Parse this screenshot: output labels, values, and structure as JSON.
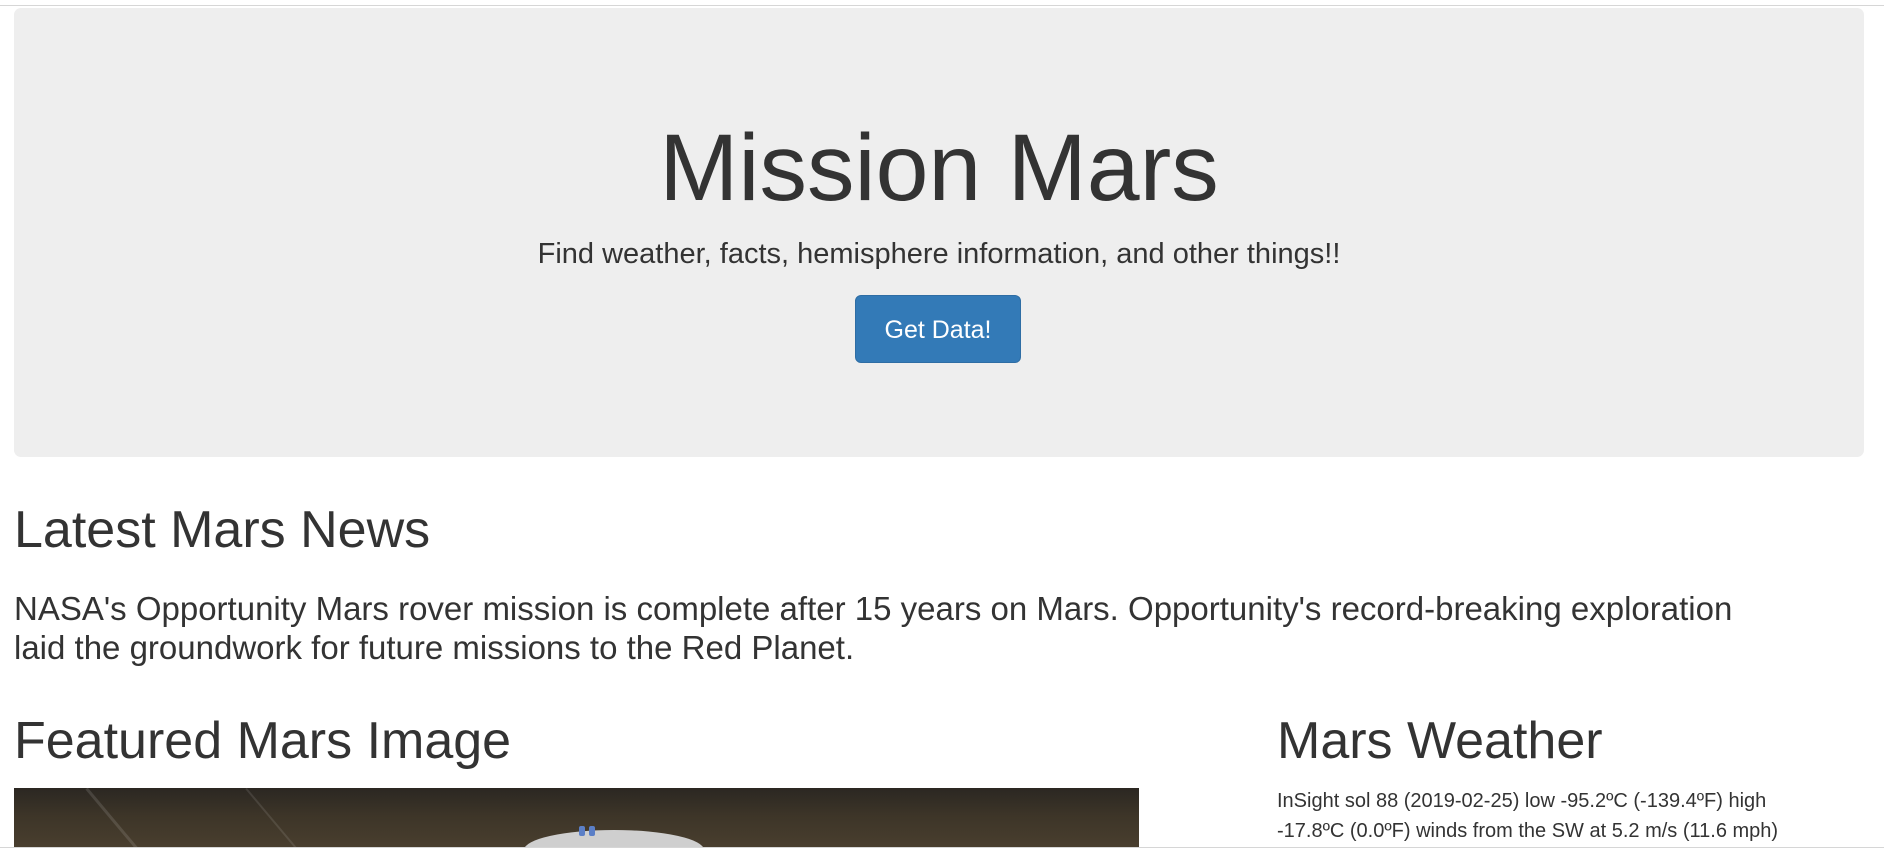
{
  "jumbotron": {
    "title": "Mission Mars",
    "subtitle": "Find weather, facts, hemisphere information, and other things!!",
    "button_label": "Get Data!"
  },
  "news": {
    "heading": "Latest Mars News",
    "paragraph": "NASA's Opportunity Mars rover mission is complete after 15 years on Mars. Opportunity's record-breaking exploration laid the groundwork for future missions to the Red Planet."
  },
  "featured_image": {
    "heading": "Featured Mars Image"
  },
  "weather": {
    "heading": "Mars Weather",
    "report": "InSight sol 88 (2019-02-25) low -95.2ºC (-139.4ºF) high -17.8ºC (0.0ºF) winds from the SW at 5.2 m/s (11.6 mph)"
  },
  "colors": {
    "jumbotron_bg": "#eeeeee",
    "button_bg": "#337ab7",
    "text": "#333333"
  }
}
